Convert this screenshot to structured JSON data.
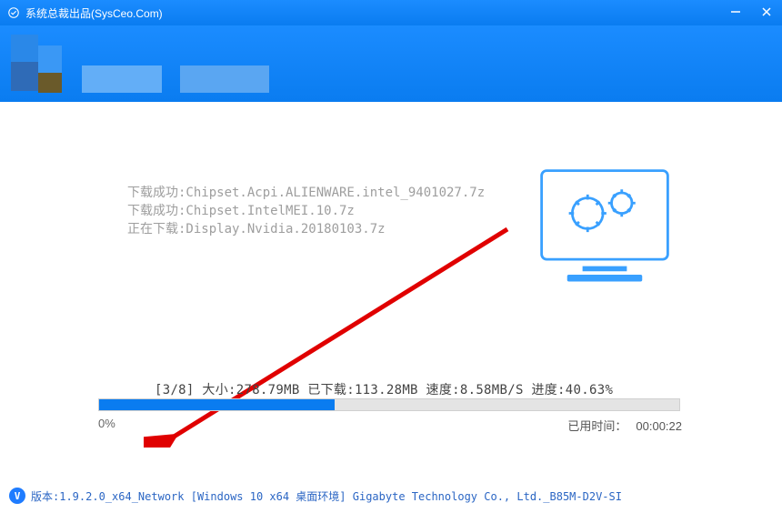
{
  "title": "系统总裁出品(SysCeo.Com)",
  "log": {
    "line1": "下载成功:Chipset.Acpi.ALIENWARE.intel_9401027.7z",
    "line2": "下载成功:Chipset.IntelMEI.10.7z",
    "line3": "正在下载:Display.Nvidia.20180103.7z"
  },
  "stats": {
    "counter": "[3/8]",
    "size_label": "大小:",
    "size_value": "278.79MB",
    "downloaded_label": "已下载:",
    "downloaded_value": "113.28MB",
    "speed_label": "速度:",
    "speed_value": "8.58MB/S",
    "progress_label": "进度:",
    "progress_value": "40.63%"
  },
  "progress": {
    "fill_percent": 40.63,
    "left_label": "0%",
    "elapsed_label": "已用时间：",
    "elapsed_value": "00:00:22"
  },
  "footer": {
    "badge": "V",
    "text": "版本:1.9.2.0_x64_Network [Windows 10 x64 桌面环境] Gigabyte Technology Co., Ltd._B85M-D2V-SI"
  }
}
